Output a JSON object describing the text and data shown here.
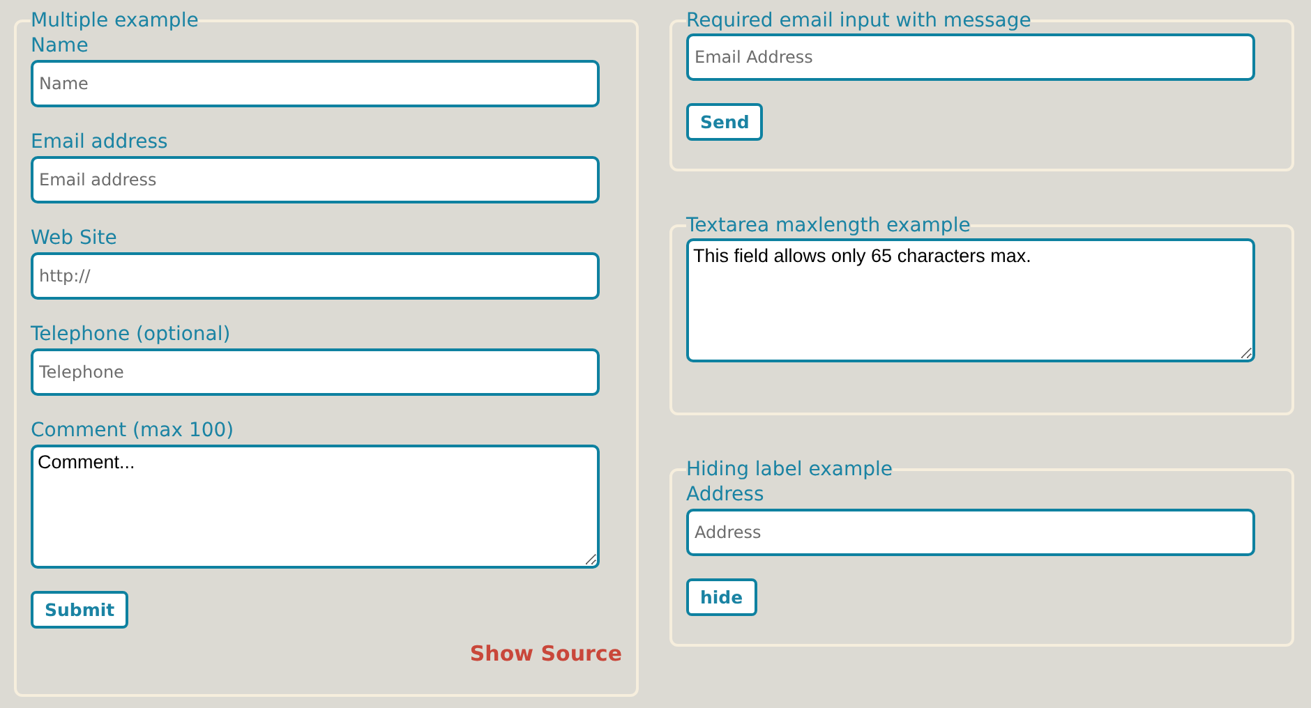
{
  "columns": [
    {
      "panels": [
        {
          "title": "Multiple example",
          "items": [
            {
              "kind": "field",
              "label": "Name",
              "placeholder": "Name"
            },
            {
              "kind": "field",
              "label": "Email address",
              "placeholder": "Email address"
            },
            {
              "kind": "field",
              "label": "Web Site",
              "placeholder": "http://"
            },
            {
              "kind": "field",
              "label": "Telephone (optional)",
              "placeholder": "Telephone"
            },
            {
              "kind": "textarea",
              "label": "Comment (max 100)",
              "value": "Comment..."
            },
            {
              "kind": "button",
              "text": "Submit"
            },
            {
              "kind": "link",
              "text": "Show Source"
            }
          ]
        }
      ]
    },
    {
      "panels": [
        {
          "title": "Required email input with message",
          "items": [
            {
              "kind": "field",
              "placeholder": "Email Address"
            },
            {
              "kind": "button",
              "text": "Send"
            }
          ]
        },
        {
          "title": "Textarea maxlength example",
          "items": [
            {
              "kind": "textarea",
              "value": "This field allows only 65 characters max."
            }
          ]
        },
        {
          "title": "Hiding label example",
          "items": [
            {
              "kind": "field",
              "label": "Address",
              "placeholder": "Address"
            },
            {
              "kind": "button",
              "text": "hide"
            }
          ]
        }
      ]
    }
  ]
}
